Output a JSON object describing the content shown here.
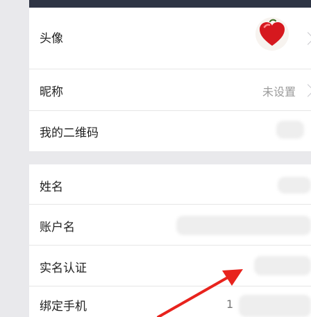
{
  "profile": {
    "avatar_label": "头像",
    "nickname_label": "昵称",
    "nickname_value": "未设置",
    "qrcode_label": "我的二维码"
  },
  "account": {
    "name_label": "姓名",
    "account_name_label": "账户名",
    "realname_label": "实名认证",
    "phone_label": "绑定手机",
    "phone_value_partial": "1"
  },
  "colors": {
    "header_bar": "#2e3444",
    "annotation_arrow": "#e8231d",
    "avatar_heart": "#d6181e"
  }
}
